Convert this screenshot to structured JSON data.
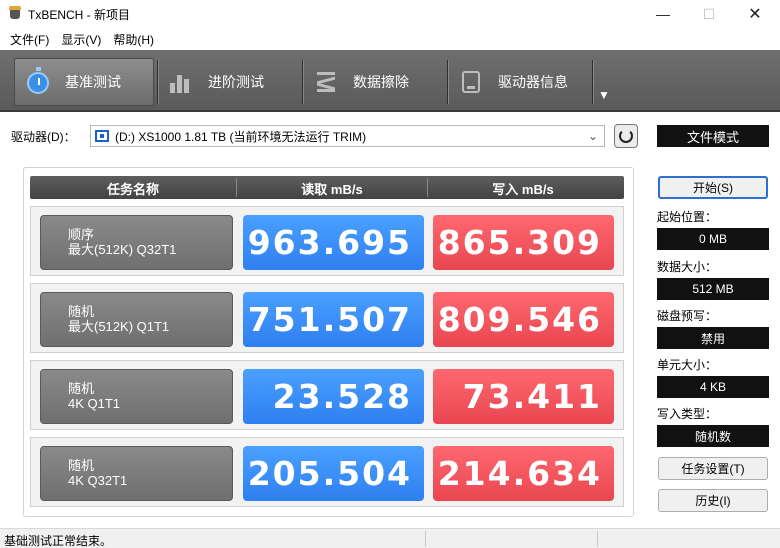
{
  "window": {
    "title": "TxBENCH - 新项目",
    "minimize": "—",
    "maximize": "☐",
    "close": "✕"
  },
  "menu": [
    "文件(F)",
    "显示(V)",
    "帮助(H)"
  ],
  "toolbar": {
    "tabs": [
      {
        "label": "基准测试",
        "icon": "stopwatch-icon",
        "active": true
      },
      {
        "label": "进阶测试",
        "icon": "bar-chart-icon",
        "active": false
      },
      {
        "label": "数据擦除",
        "icon": "eraser-spring-icon",
        "active": false
      },
      {
        "label": "驱动器信息",
        "icon": "drive-info-icon",
        "active": false
      }
    ],
    "more": "▼"
  },
  "drive": {
    "label": "驱动器(D)：",
    "selected": "(D:) XS1000  1.81 TB (当前环境无法运行 TRIM)",
    "mode": "文件模式"
  },
  "table": {
    "headers": [
      "任务名称",
      "读取 mB/s",
      "写入 mB/s"
    ],
    "rows": [
      {
        "line1": "顺序",
        "line2": "最大(512K) Q32T1",
        "read": "963.695",
        "write": "865.309"
      },
      {
        "line1": "随机",
        "line2": "最大(512K) Q1T1",
        "read": "751.507",
        "write": "809.546"
      },
      {
        "line1": "随机",
        "line2": "4K Q1T1",
        "read": "23.528",
        "write": "73.411"
      },
      {
        "line1": "随机",
        "line2": "4K Q32T1",
        "read": "205.504",
        "write": "214.634"
      }
    ]
  },
  "sidebar": {
    "start": "开始(S)",
    "start_pos_label": "起始位置：",
    "start_pos": "0 MB",
    "data_size_label": "数据大小：",
    "data_size": "512 MB",
    "precondition_label": "磁盘预写：",
    "precondition": "禁用",
    "block_size_label": "单元大小：",
    "block_size": "4 KB",
    "write_type_label": "写入类型：",
    "write_type": "随机数",
    "task_settings": "任务设置(T)",
    "history": "历史(I)"
  },
  "status": {
    "text": "基础测试正常结束。"
  },
  "colors": {
    "read": "#3a8cf8",
    "write": "#f0525a",
    "toolbar": "#636363"
  }
}
